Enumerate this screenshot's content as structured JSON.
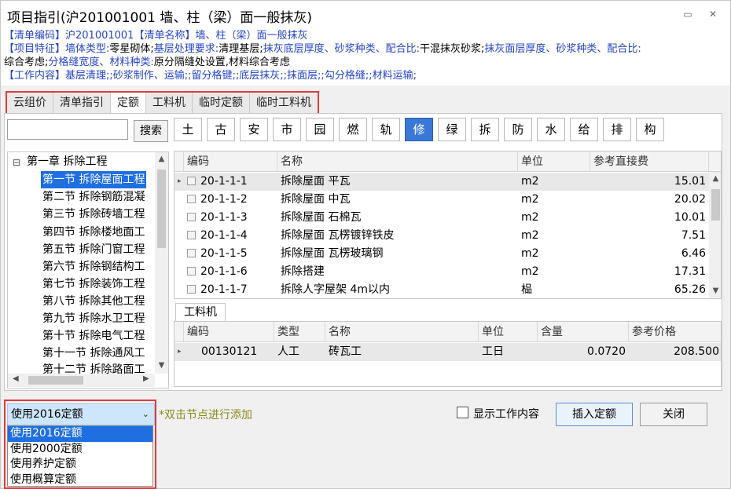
{
  "window": {
    "title": "项目指引(沪201001001  墙、柱（梁）面一般抹灰)"
  },
  "info": {
    "line1_label1": "【清单编码】",
    "line1_code": "沪201001001",
    "line1_label2": "【清单名称】",
    "line1_name": "墙、柱（梁）面一般抹灰",
    "line2_label": "【项目特征】",
    "line2_a": "墙体类型:",
    "line2_b": "零星砌体;",
    "line2_c": "基层处理要求:",
    "line2_d": "清理基层;",
    "line2_e": "抹灰底层厚度、砂浆种类、配合比:",
    "line2_f": "干混抹灰砂浆;",
    "line2_g": "抹灰面层厚度、砂浆种类、配合比:",
    "line3_a": "综合考虑;",
    "line3_b": "分格缝宽度、材料种类:",
    "line3_c": "原分隔缝处设置,材料综合考虑",
    "line4_label": "【工作内容】",
    "line4_text": "基层清理;;砂浆制作、运输;;留分格键;;底层抹灰;;抹面层;;勾分格缝;;材料运输;"
  },
  "tabs": [
    "云组价",
    "清单指引",
    "定额",
    "工料机",
    "临时定额",
    "临时工料机"
  ],
  "search": {
    "value": "",
    "button": "搜索"
  },
  "categories": [
    "土",
    "古",
    "安",
    "市",
    "园",
    "燃",
    "轨",
    "修",
    "绿",
    "拆",
    "防",
    "水",
    "给",
    "排",
    "构"
  ],
  "tree": {
    "root": "第一章 拆除工程",
    "items": [
      "第一节 拆除屋面工程",
      "第二节 拆除钢筋混凝",
      "第三节 拆除砖墙工程",
      "第四节 拆除楼地面工",
      "第五节 拆除门窗工程",
      "第六节 拆除钢结构工",
      "第七节 拆除装饰工程",
      "第八节 拆除其他工程",
      "第九节 拆除水卫工程",
      "第十节 拆除电气工程",
      "第十一节 拆除通风工",
      "第十二节 拆除路面工"
    ]
  },
  "quota_table": {
    "headers": [
      "编码",
      "名称",
      "单位",
      "参考直接费"
    ],
    "rows": [
      {
        "code": "20-1-1-1",
        "name": "拆除屋面 平瓦",
        "unit": "m2",
        "fee": "15.01"
      },
      {
        "code": "20-1-1-2",
        "name": "拆除屋面 中瓦",
        "unit": "m2",
        "fee": "20.02"
      },
      {
        "code": "20-1-1-3",
        "name": "拆除屋面 石棉瓦",
        "unit": "m2",
        "fee": "10.01"
      },
      {
        "code": "20-1-1-4",
        "name": "拆除屋面 瓦楞镀锌铁皮",
        "unit": "m2",
        "fee": "7.51"
      },
      {
        "code": "20-1-1-5",
        "name": "拆除屋面 瓦楞玻璃钢",
        "unit": "m2",
        "fee": "6.46"
      },
      {
        "code": "20-1-1-6",
        "name": "拆除搭建",
        "unit": "m2",
        "fee": "17.31"
      },
      {
        "code": "20-1-1-7",
        "name": "拆除人字屋架 4m以内",
        "unit": "榀",
        "fee": "65.26"
      }
    ]
  },
  "sub_tab": "工料机",
  "material_table": {
    "headers": [
      "编码",
      "类型",
      "名称",
      "单位",
      "含量",
      "参考价格"
    ],
    "rows": [
      {
        "code": "00130121",
        "type": "人工",
        "name": "砖瓦工",
        "unit": "工日",
        "amount": "0.0720",
        "price": "208.500"
      }
    ]
  },
  "quota_select": {
    "selected": "使用2016定额",
    "options": [
      "使用2016定额",
      "使用2000定额",
      "使用养护定额",
      "使用概算定额"
    ]
  },
  "hint": "*双击节点进行添加",
  "show_work_content": "显示工作内容",
  "buttons": {
    "insert": "插入定额",
    "close": "关闭"
  }
}
